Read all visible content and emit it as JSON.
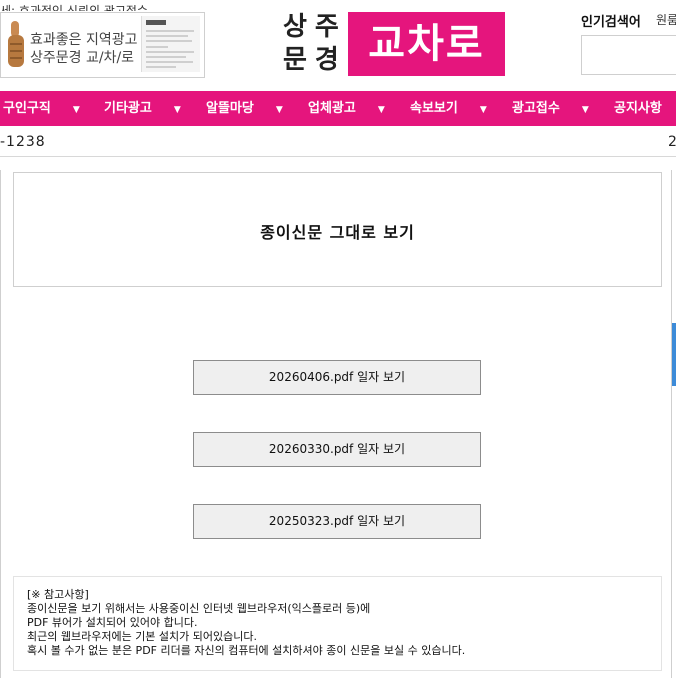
{
  "header": {
    "ticker_text": "세: 효과적인 신뢰의 광고접수",
    "ad": {
      "line1": "효과좋은 지역광고",
      "line2": "상주문경 교/차/로"
    },
    "logo": {
      "region_top": "상주",
      "region_bottom": "문경",
      "brand": "교차로"
    },
    "popular": {
      "title": "인기검색어",
      "first_keyword": "원룸"
    }
  },
  "nav": {
    "items": [
      {
        "label": "구인구직"
      },
      {
        "label": "기타광고"
      },
      {
        "label": "알뜰마당"
      },
      {
        "label": "업체광고"
      },
      {
        "label": "속보보기"
      },
      {
        "label": "광고접수"
      },
      {
        "label": "공지사항"
      }
    ],
    "arrow": "▼"
  },
  "info": {
    "phone": "-1238",
    "right_text": "2"
  },
  "main": {
    "title": "종이신문 그대로 보기",
    "pdf_buttons": [
      {
        "label": "20260406.pdf 일자 보기"
      },
      {
        "label": "20260330.pdf 일자 보기"
      },
      {
        "label": "20250323.pdf 일자 보기"
      }
    ],
    "notice": {
      "heading": "[※ 참고사항]",
      "lines": [
        "종이신문을 보기 위해서는 사용중이신 인터넷 웹브라우저(익스플로러 등)에",
        "PDF 뷰어가 설치되어 있어야 합니다.",
        "최근의 웹브라우저에는 기본 설치가 되어있습니다.",
        "혹시 볼 수가 없는 분은 PDF 리더를 자신의 컴퓨터에 설치하셔야 종이 신문을 보실 수 있습니다."
      ]
    }
  },
  "colors": {
    "brand_pink": "#e5157d",
    "accent_blue": "#3d8bd8"
  }
}
